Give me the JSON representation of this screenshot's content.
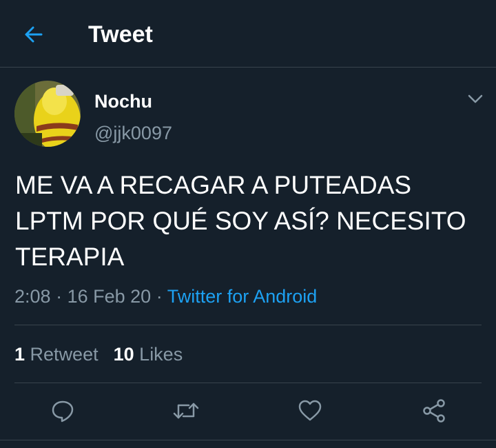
{
  "header": {
    "title": "Tweet",
    "back_icon": "arrow-left-icon",
    "accent_color": "#1da1f2"
  },
  "user": {
    "name": "Nochu",
    "handle": "@jjk0097",
    "avatar_icon": "avatar-photo"
  },
  "tweet": {
    "text": "ME VA A RECAGAR A PUTEADAS\nLPTM POR QUÉ SOY ASÍ? NECESITO\nTERAPIA",
    "time": "2:08",
    "separator": "·",
    "date": "16 Feb 20",
    "source": "Twitter for Android"
  },
  "stats": {
    "retweets_count": "1",
    "retweets_label": "Retweet",
    "likes_count": "10",
    "likes_label": "Likes"
  },
  "actions": [
    {
      "name": "reply",
      "icon": "reply-icon"
    },
    {
      "name": "retweet",
      "icon": "retweet-icon"
    },
    {
      "name": "like",
      "icon": "heart-icon"
    },
    {
      "name": "share",
      "icon": "share-icon"
    }
  ],
  "colors": {
    "background": "#15202b",
    "divider": "#38444d",
    "secondary_text": "#8899a6",
    "link": "#1da1f2"
  }
}
